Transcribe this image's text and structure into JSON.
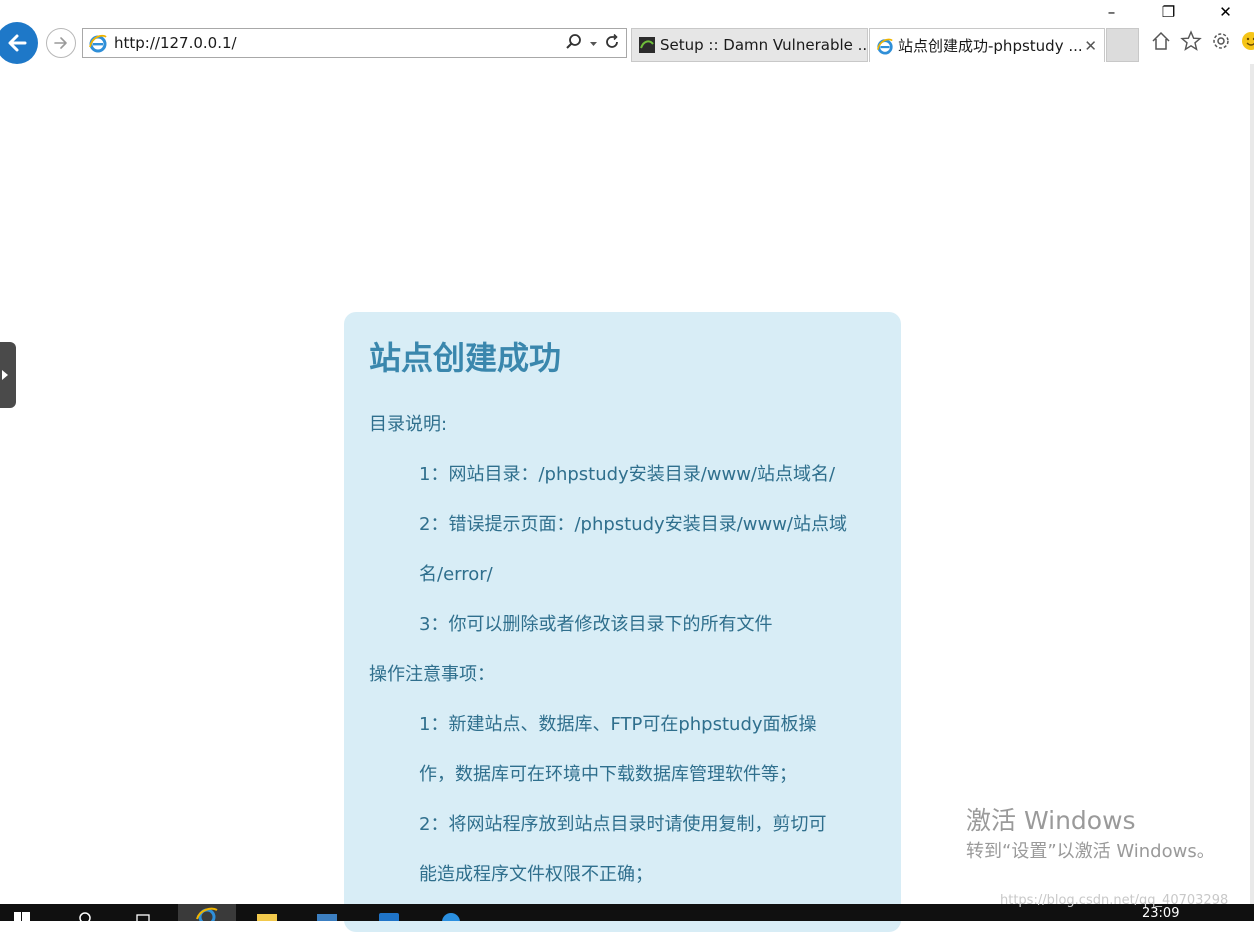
{
  "browser": {
    "address_url": "http://127.0.0.1/",
    "tabs": [
      {
        "title": "Setup :: Damn Vulnerable ...",
        "active": false
      },
      {
        "title": "站点创建成功-phpstudy ...",
        "active": true
      }
    ],
    "window_controls": {
      "minimize": "–",
      "restore": "❐",
      "close": "✕"
    },
    "tab_close": "✕",
    "icons": [
      "back-arrow-icon",
      "forward-arrow-icon",
      "ie-icon",
      "search-icon",
      "dropdown-icon",
      "refresh-icon",
      "home-icon",
      "favorites-star-icon",
      "settings-gear-icon",
      "smiley-feedback-icon"
    ]
  },
  "page": {
    "title": "站点创建成功",
    "sections": [
      {
        "heading": "目录说明:",
        "items": [
          "1：网站目录：/phpstudy安装目录/www/站点域名/",
          "2：错误提示页面：/phpstudy安装目录/www/站点域",
          "名/error/",
          "3：你可以删除或者修改该目录下的所有文件"
        ]
      },
      {
        "heading": "操作注意事项：",
        "items": [
          "1：新建站点、数据库、FTP可在phpstudy面板操",
          "作，数据库可在环境中下载数据库管理软件等；",
          "2：将网站程序放到站点目录时请使用复制，剪切可",
          "能造成程序文件权限不正确；"
        ]
      }
    ]
  },
  "watermark": {
    "title": "激活 Windows",
    "subtitle": "转到“设置”以激活 Windows。"
  },
  "taskbar": {
    "clock": "23:09",
    "csdn_url": "https://blog.csdn.net/qq_40703298"
  },
  "colors": {
    "card_bg": "#d8edf6",
    "heading": "#3a87ad",
    "text": "#2f6f8d",
    "back_button": "#1e78c8"
  }
}
